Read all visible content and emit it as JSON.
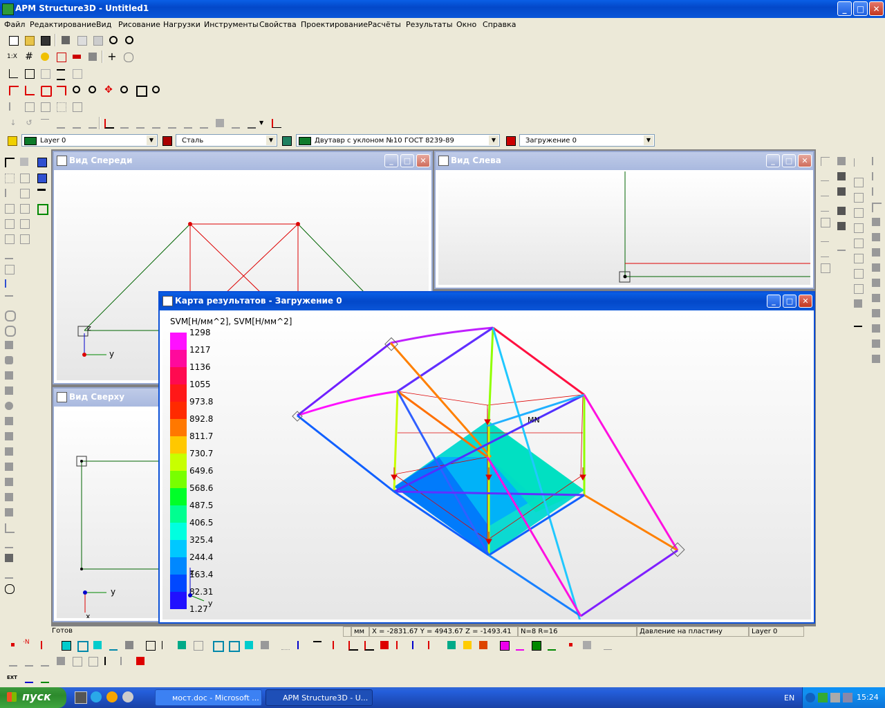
{
  "app": {
    "title": "APM Structure3D - Untitled1"
  },
  "menu": [
    "Файл",
    "Редактирование",
    "Вид",
    "Рисование",
    "Нагрузки",
    "Инструменты",
    "Свойства",
    "Проектирование",
    "Расчёты",
    "Результаты",
    "Окно",
    "Справка"
  ],
  "toolbar2": {
    "label_1x": "1:X"
  },
  "props": {
    "layer": "Layer 0",
    "material": "Сталь",
    "section": "Двутавр с уклоном  №10 ГОСТ 8239-89",
    "loadcase": "Загружение 0"
  },
  "windows": {
    "front": {
      "title": "Вид Спереди"
    },
    "left": {
      "title": "Вид Слева"
    },
    "top": {
      "title": "Вид Сверху"
    },
    "result": {
      "title": "Карта результатов - Загружение 0"
    }
  },
  "result": {
    "legend_title": "SVM[Н/мм^2], SVM[Н/мм^2]",
    "legend_values": [
      "1298",
      "1217",
      "1136",
      "1055",
      "973.8",
      "892.8",
      "811.7",
      "730.7",
      "649.6",
      "568.6",
      "487.5",
      "406.5",
      "325.4",
      "244.4",
      "163.4",
      "82.31",
      "1.27"
    ],
    "legend_colors": [
      "#ff10ff",
      "#ff0a9c",
      "#ff0a50",
      "#ff1818",
      "#ff2a00",
      "#ff7800",
      "#ffc800",
      "#c8ff00",
      "#78ff00",
      "#00ff28",
      "#00ff90",
      "#00ffe0",
      "#00c8ff",
      "#0088ff",
      "#0048ff",
      "#2010ff"
    ],
    "label_mn": "MN",
    "axis_y": "y",
    "axis_z": "z"
  },
  "axes": {
    "y": "y",
    "z": "z",
    "x": "x"
  },
  "status": {
    "ready": "Готов",
    "units": "мм",
    "coords": "X = -2831.67 Y = 4943.67 Z = -1493.41",
    "nr": "N=8 R=16",
    "mode": "Давление на пластину",
    "layer": "Layer 0"
  },
  "bottom_toolbar": {
    "ext_label": "EXT"
  },
  "taskbar": {
    "start": "пуск",
    "tasks": [
      "мост.doc - Microsoft ...",
      "APM Structure3D - U..."
    ],
    "lang": "EN",
    "clock": "15:24"
  }
}
